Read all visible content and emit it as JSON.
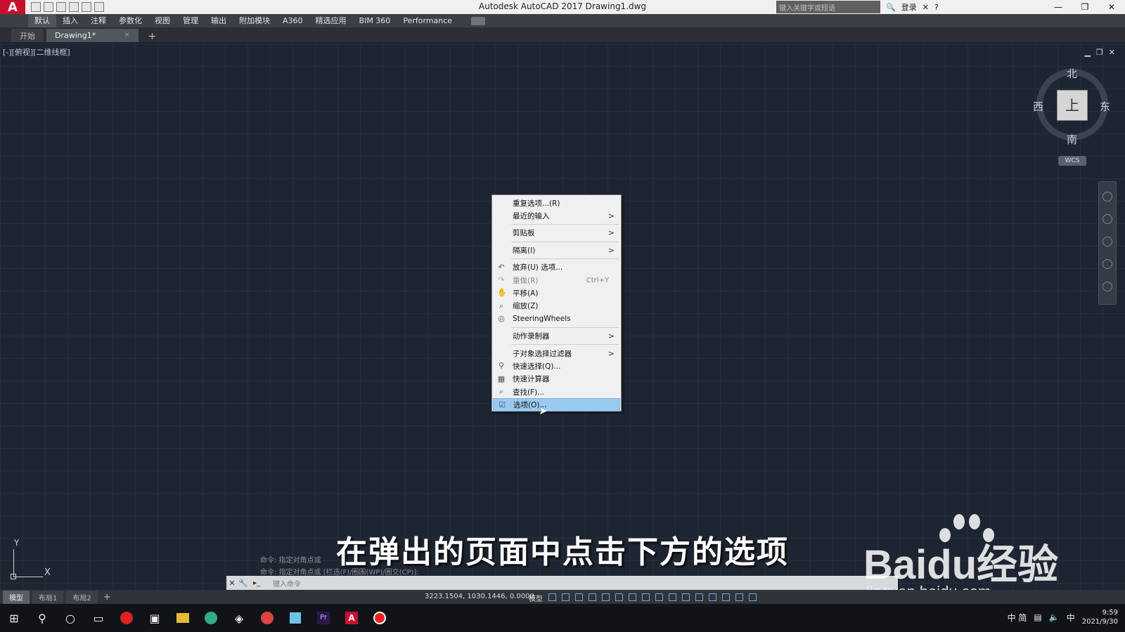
{
  "window": {
    "app_logo": "A",
    "title": "Autodesk AutoCAD 2017    Drawing1.dwg",
    "search_placeholder": "键入关键字或短语",
    "login_label": "登录"
  },
  "ribbon": {
    "tabs": [
      "默认",
      "插入",
      "注释",
      "参数化",
      "视图",
      "管理",
      "输出",
      "附加模块",
      "A360",
      "精选应用",
      "BIM 360",
      "Performance"
    ]
  },
  "doc_tabs": {
    "start": "开始",
    "drawing": "Drawing1*",
    "add": "+"
  },
  "viewport": {
    "label": "[-][俯视][二维线框]"
  },
  "viewcube": {
    "north": "北",
    "south": "南",
    "east": "东",
    "west": "西",
    "face": "上",
    "wcs": "WCS"
  },
  "ucs": {
    "x": "X",
    "y": "Y"
  },
  "context_menu": {
    "items": [
      {
        "label": "重复选项...(R)"
      },
      {
        "label": "最近的输入",
        "submenu": ">"
      },
      {
        "label": "剪贴板",
        "submenu": ">"
      },
      {
        "label": "隔离(I)",
        "submenu": ">"
      },
      {
        "label": "放弃(U) 选项..."
      },
      {
        "label": "重做(R)",
        "shortcut": "Ctrl+Y"
      },
      {
        "label": "平移(A)"
      },
      {
        "label": "缩放(Z)"
      },
      {
        "label": "SteeringWheels"
      },
      {
        "label": "动作录制器",
        "submenu": ">"
      },
      {
        "label": "子对象选择过滤器",
        "submenu": ">"
      },
      {
        "label": "快速选择(Q)..."
      },
      {
        "label": "快速计算器"
      },
      {
        "label": "查找(F)..."
      },
      {
        "label": "选项(O)..."
      }
    ]
  },
  "command": {
    "history_1": "命令: 指定对角点或",
    "history_2": "命令: 指定对角点或 [栏选(F)/圈围(WP)/圈交(CP)]:",
    "input_placeholder": "键入命令"
  },
  "subtitle": "在弹出的页面中点击下方的选项",
  "watermark": {
    "logo_prefix": "Bai",
    "logo_du": "du",
    "logo_cn": "经验",
    "url": "jingyan.baidu.com"
  },
  "statusbar": {
    "layout_tabs": [
      "模型",
      "布局1",
      "布局2"
    ],
    "coordinates": "3223.1504, 1030.1446, 0.0000",
    "model_label": "模型"
  },
  "taskbar": {
    "tray_text": "中 简",
    "ime": "中",
    "time": "9:59",
    "date": "2021/9/30"
  }
}
